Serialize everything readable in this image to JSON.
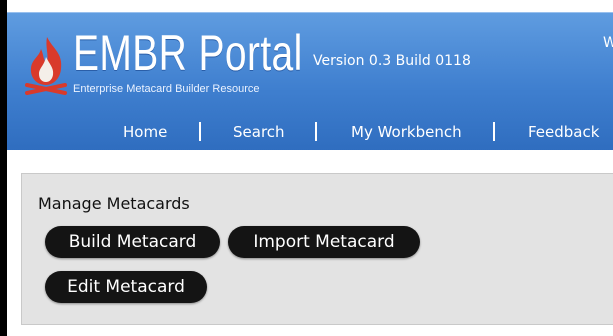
{
  "header": {
    "title": "EMBR Portal",
    "subtitle": "Enterprise Metacard Builder Resource",
    "version": "Version 0.3 Build 0118",
    "corner_text": "W"
  },
  "nav": {
    "items": [
      {
        "label": "Home"
      },
      {
        "label": "Search"
      },
      {
        "label": "My Workbench"
      },
      {
        "label": "Feedback"
      }
    ]
  },
  "manage": {
    "title": "Manage Metacards",
    "buttons": {
      "build": "Build Metacard",
      "import": "Import Metacard",
      "edit": "Edit Metacard"
    }
  },
  "colors": {
    "header_blue": "#3f7fcf",
    "flame_red": "#d93a2b",
    "button_black": "#141414",
    "panel_gray": "#e3e3e3"
  },
  "icons": [
    "flame-logo-icon"
  ]
}
